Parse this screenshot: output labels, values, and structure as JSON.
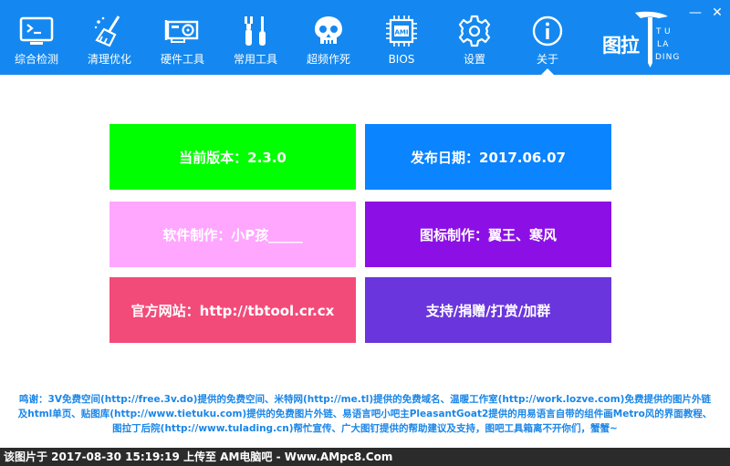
{
  "nav": {
    "tabs": [
      {
        "label": "综合检测",
        "icon": "monitor-icon"
      },
      {
        "label": "清理优化",
        "icon": "broom-icon"
      },
      {
        "label": "硬件工具",
        "icon": "graphics-card-icon"
      },
      {
        "label": "常用工具",
        "icon": "tools-icon"
      },
      {
        "label": "超频作死",
        "icon": "skull-icon"
      },
      {
        "label": "BIOS",
        "icon": "chip-icon"
      },
      {
        "label": "设置",
        "icon": "gear-icon"
      },
      {
        "label": "关于",
        "icon": "info-icon"
      }
    ],
    "active": "关于"
  },
  "brand": {
    "text": "图拉",
    "letters": [
      "T",
      "U",
      "LA",
      "DING"
    ],
    "icon": "tulading-logo-icon"
  },
  "window": {
    "minimize": "—",
    "close": "✕"
  },
  "cards": [
    {
      "text": "当前版本：2.3.0",
      "color": "#00ff00"
    },
    {
      "text": "发布日期：2017.06.07",
      "color": "#0a84ff"
    },
    {
      "text": "软件制作：小P孩_____",
      "color": "#ffa6ff"
    },
    {
      "text": "图标制作：翼王、寒风",
      "color": "#8c10e6"
    },
    {
      "text": "官方网站：http://tbtool.cr.cx",
      "color": "#f24b79"
    },
    {
      "text": "支持/捐赠/打赏/加群",
      "color": "#6a35dc"
    }
  ],
  "credits": {
    "line1": "鸣谢：3V免费空间(http://free.3v.do)提供的免费空间、米特网(http://me.tl)提供的免费域名、温暖工作室(http://work.lozve.com)免费提供的图片外链",
    "line2": "及html单页、贴图库(http://www.tietuku.com)提供的免费图片外链、易语言吧小吧主PleasantGoat2提供的用易语言自带的组件画Metro风的界面教程、",
    "line3": "图拉丁后院(http://www.tulading.cn)帮忙宣传、广大图钉提供的帮助建议及支持，图吧工具箱离不开你们，蟹蟹~"
  },
  "watermark": "该图片于  2017-08-30  15:19:19  上传至  AM电脑吧  -  Www.AMpc8.Com",
  "colors": {
    "topbar": "#1488f0",
    "credits_text": "#1a86e8",
    "watermark_bg": "#2b2b2b"
  }
}
